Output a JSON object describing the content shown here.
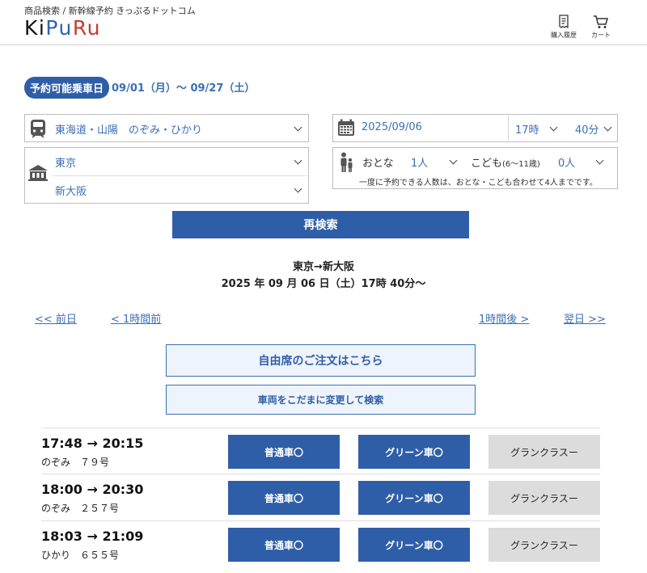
{
  "header": {
    "breadcrumb": "商品検索 / 新幹線予約 きっぷるドットコム",
    "logo": [
      "K",
      "i",
      "P",
      "u",
      "R",
      "u"
    ],
    "purchase_history": "購入履歴",
    "cart": "カート"
  },
  "period": {
    "badge": "予約可能乗車日",
    "range": "09/01（月）～ 09/27（土）"
  },
  "form": {
    "line": "東海道・山陽　のぞみ・ひかり",
    "date": "2025/09/06",
    "hour": "17時",
    "minute": "40分",
    "from": "東京",
    "to": "新大阪",
    "adult_label": "おとな",
    "adult_value": "1人",
    "child_label": "こども",
    "child_age": "(6～11歳)",
    "child_value": "0人",
    "note": "一度に予約できる人数は、おとな・こども合わせて4人までです。"
  },
  "research_label": "再検索",
  "route": {
    "title": "東京→新大阪",
    "datetime": "2025 年 09 月 06 日（土）17時 40分～"
  },
  "nav": {
    "prev_day": "<< 前日",
    "prev_hour": "< 1時間前",
    "next_hour": "1時間後 >",
    "next_day": "翌日 >>"
  },
  "free_seat_label": "自由席のご注文はこちら",
  "change_car_label": "車両をこだまに変更して検索",
  "trains": [
    {
      "time": "17:48 → 20:15",
      "name": "のぞみ　７９号",
      "ordinary": "普通車〇",
      "green": "グリーン車〇",
      "gran": "グランクラスー"
    },
    {
      "time": "18:00 → 20:30",
      "name": "のぞみ　２５７号",
      "ordinary": "普通車〇",
      "green": "グリーン車〇",
      "gran": "グランクラスー"
    },
    {
      "time": "18:03 → 21:09",
      "name": "ひかり　６５５号",
      "ordinary": "普通車〇",
      "green": "グリーン車〇",
      "gran": "グランクラスー"
    }
  ],
  "colors": {
    "primary": "#2f5ea8",
    "link": "#3b6fb4",
    "disabled": "#dcdcdc"
  }
}
